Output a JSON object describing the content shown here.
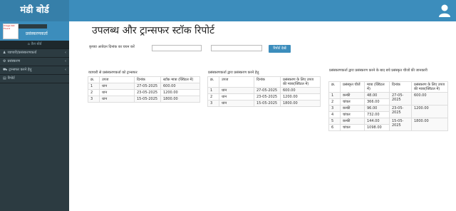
{
  "header": {
    "brand": "मंडी बोर्ड",
    "user_icon": "user-icon"
  },
  "sidebar": {
    "logo_alt": "Image Not Found",
    "role": "प्रसंस्करणकर्ता",
    "items": [
      {
        "label": "डैश बोर्ड",
        "icon": "dashboard-icon",
        "type": "sub"
      },
      {
        "label": "व्यापारी/प्रसंस्करणकर्ता",
        "icon": "users-icon",
        "type": "item"
      },
      {
        "label": "प्रसंस्करण",
        "icon": "gear-icon",
        "type": "item"
      },
      {
        "label": "ट्रान्सफर करने हेतु",
        "icon": "truck-icon",
        "type": "item"
      },
      {
        "label": "रिपोर्ट",
        "icon": "report-icon",
        "type": "item"
      }
    ]
  },
  "main": {
    "title": "उपलब्ध और ट्रान्सफर स्टॉक रिपोर्ट",
    "date_label": "कृपया आवेदन दिनांक का चयन करें",
    "date_from": "",
    "date_to": "",
    "view_button": "रिपोर्ट देखें"
  },
  "table1": {
    "title": "व्यापारी से प्रसंस्करणकर्ता को ट्रान्सफर",
    "headers": [
      "क्र.",
      "उपज",
      "दिनांक",
      "स्टॉक मात्रा (क्विंटल में)"
    ],
    "rows": [
      [
        "1",
        "धान",
        "27-05-2025",
        "600.00"
      ],
      [
        "2",
        "धान",
        "23-05-2025",
        "1200.00"
      ],
      [
        "3",
        "धान",
        "15-05-2025",
        "1800.00"
      ]
    ]
  },
  "table2": {
    "title": "प्रसंस्करणकर्ता द्वारा प्रसंस्करण करने हेतु",
    "headers": [
      "क्र.",
      "उपज",
      "दिनांक",
      "प्रसंस्करण के लिए उपज की मात्रा(क्विंटल में)"
    ],
    "rows": [
      [
        "1",
        "धान",
        "27-05-2025",
        "600.00"
      ],
      [
        "2",
        "धान",
        "23-05-2025",
        "1200.00"
      ],
      [
        "3",
        "धान",
        "15-05-2025",
        "1800.00"
      ]
    ]
  },
  "table3": {
    "title": "प्रसंस्करणकर्ता द्वारा प्रसंस्करण करने के बाद बचे प्रसंस्कृत चीजों की जानकारी",
    "headers": [
      "क्र.",
      "प्रसंस्कृत चीजें",
      "मात्रा (क्विंटल में)",
      "दिनांक",
      "प्रसंस्करण के लिए उपज की मात्रा(क्विंटल में)"
    ],
    "rows": [
      [
        "1",
        "कन्की",
        "48.00",
        "27-05-2025",
        "600.00"
      ],
      [
        "2",
        "चांवल",
        "366.00",
        "",
        ""
      ],
      [
        "3",
        "कन्की",
        "96.00",
        "23-05-2025",
        "1200.00"
      ],
      [
        "4",
        "चांवल",
        "732.00",
        "",
        ""
      ],
      [
        "5",
        "कन्की",
        "144.00",
        "15-05-2025",
        "1800.00"
      ],
      [
        "6",
        "चांवल",
        "1098.00",
        "",
        ""
      ]
    ]
  }
}
